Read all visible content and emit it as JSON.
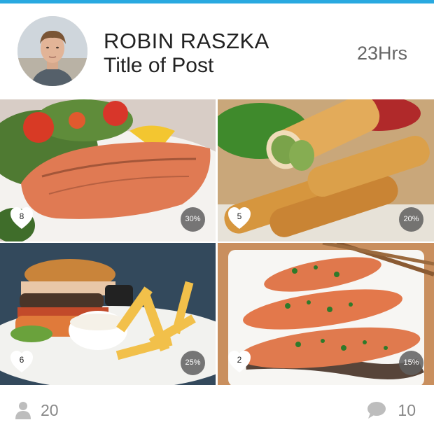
{
  "post": {
    "author": "ROBIN RASZKA",
    "title": "Title of Post",
    "time_ago": "23Hrs"
  },
  "tiles": [
    {
      "dish": "grilled salmon with salad",
      "likes": "8",
      "percent": "30%"
    },
    {
      "dish": "spring rolls",
      "likes": "5",
      "percent": "20%"
    },
    {
      "dish": "burger and fries",
      "likes": "6",
      "percent": "25%"
    },
    {
      "dish": "glazed salmon with green onions",
      "likes": "2",
      "percent": "15%"
    }
  ],
  "footer": {
    "followers_count": "20",
    "comments_count": "10"
  },
  "colors": {
    "accent_bar": "#29a9e0",
    "text_primary": "#222222",
    "text_muted": "#888888",
    "badge_bg": "#5f5f5f"
  },
  "icons": {
    "like": "heart-icon",
    "followers": "person-icon",
    "comments": "speech-bubble-icon"
  }
}
